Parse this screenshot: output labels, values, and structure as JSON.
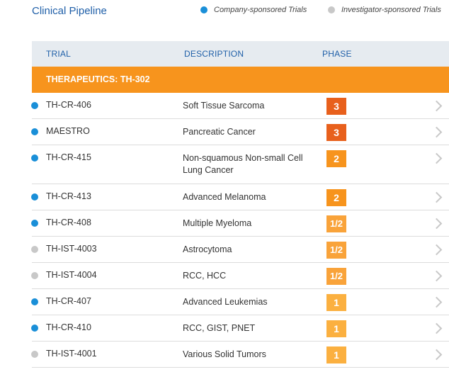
{
  "header": {
    "title": "Clinical Pipeline",
    "legend": [
      {
        "label": "Company-sponsored Trials",
        "color": "#1a8fd8"
      },
      {
        "label": "Investigator-sponsored Trials",
        "color": "#c8c8c8"
      }
    ]
  },
  "table": {
    "columns": [
      "TRIAL",
      "DESCRIPTION",
      "PHASE"
    ],
    "group": "THERAPEUTICS: TH-302",
    "rows": [
      {
        "trial": "TH-CR-406",
        "description": "Soft Tissue Sarcoma",
        "phase": "3",
        "sponsor": "company"
      },
      {
        "trial": "MAESTRO",
        "description": "Pancreatic Cancer",
        "phase": "3",
        "sponsor": "company"
      },
      {
        "trial": "TH-CR-415",
        "description": "Non-squamous Non-small Cell Lung Cancer",
        "phase": "2",
        "sponsor": "company"
      },
      {
        "trial": "TH-CR-413",
        "description": "Advanced Melanoma",
        "phase": "2",
        "sponsor": "company"
      },
      {
        "trial": "TH-CR-408",
        "description": "Multiple Myeloma",
        "phase": "1/2",
        "sponsor": "company"
      },
      {
        "trial": "TH-IST-4003",
        "description": "Astrocytoma",
        "phase": "1/2",
        "sponsor": "investigator"
      },
      {
        "trial": "TH-IST-4004",
        "description": "RCC, HCC",
        "phase": "1/2",
        "sponsor": "investigator"
      },
      {
        "trial": "TH-CR-407",
        "description": "Advanced Leukemias",
        "phase": "1",
        "sponsor": "company"
      },
      {
        "trial": "TH-CR-410",
        "description": "RCC, GIST, PNET",
        "phase": "1",
        "sponsor": "company"
      },
      {
        "trial": "TH-IST-4001",
        "description": "Various Solid Tumors",
        "phase": "1",
        "sponsor": "investigator"
      }
    ]
  },
  "colors": {
    "company": "#1a8fd8",
    "investigator": "#c8c8c8",
    "phase_3": "#e8601c",
    "phase_2": "#f7941d",
    "phase_1_2": "#f9a33a",
    "phase_1": "#fbb040",
    "group_band": "#f7941d",
    "title": "#1f5fa8"
  }
}
